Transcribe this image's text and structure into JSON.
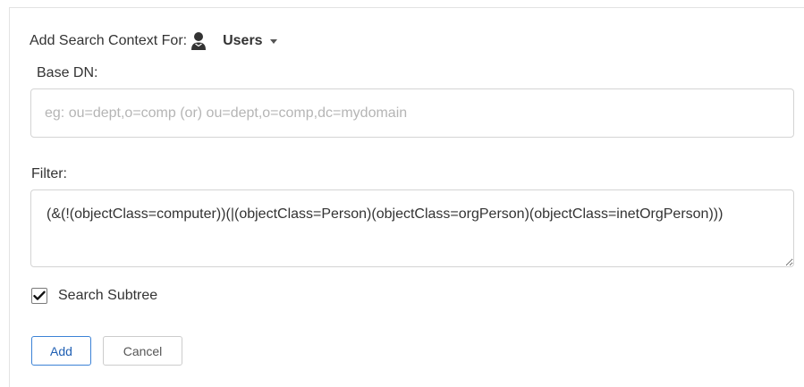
{
  "header": {
    "title": "Add Search Context For:",
    "context_value": "Users",
    "icons": {
      "user": "user-icon",
      "caret": "chevron-down-icon"
    }
  },
  "base_dn": {
    "label": "Base DN:",
    "value": "",
    "placeholder": "eg: ou=dept,o=comp (or) ou=dept,o=comp,dc=mydomain"
  },
  "filter": {
    "label": "Filter:",
    "value": "(&(!(objectClass=computer))(|(objectClass=Person)(objectClass=orgPerson)(objectClass=inetOrgPerson)))"
  },
  "search_subtree": {
    "label": "Search Subtree",
    "checked": true
  },
  "actions": {
    "add_label": "Add",
    "cancel_label": "Cancel"
  },
  "colors": {
    "primary_border": "#3b82d6",
    "primary_text": "#1f5fb3",
    "input_border": "#d4d4d4",
    "placeholder": "#b5b5b5"
  }
}
